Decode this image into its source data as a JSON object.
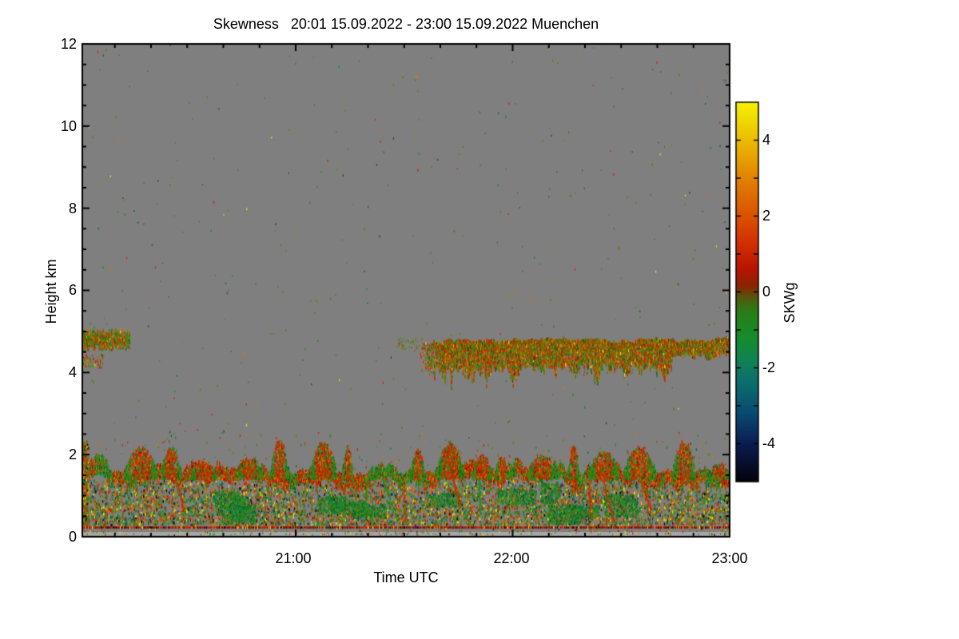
{
  "chart_data": {
    "type": "heatmap",
    "display_title": "Skewness   20:01 15.09.2022 - 23:00 15.09.2022 Muenchen",
    "variable": "Skewness",
    "time_start": "20:01 15.09.2022",
    "time_end": "23:00 15.09.2022",
    "station": "Muenchen",
    "x": {
      "label": "Time UTC",
      "range_minutes": [
        0,
        179
      ],
      "tick_minutes": [
        59,
        119,
        179
      ],
      "tick_labels": [
        "21:00",
        "22:00",
        "23:00"
      ],
      "minor_step_min": 10,
      "first_minor_min": 9
    },
    "y": {
      "label": "Height km",
      "range": [
        0,
        12
      ],
      "tick_values": [
        12,
        10,
        8,
        6,
        4,
        2,
        0
      ],
      "tick_labels": [
        "12",
        "10",
        "8",
        "6",
        "4",
        "2",
        "0"
      ],
      "minor_step": 0.5
    },
    "colorbar": {
      "label": "SKWg",
      "range": [
        -5,
        5
      ],
      "tick_values": [
        4,
        2,
        0,
        -2,
        -4
      ],
      "tick_labels": [
        "4",
        "2",
        "0",
        "-2",
        "-4"
      ],
      "minor_tick_values": [
        3,
        1,
        -1,
        -3
      ],
      "gradient_stops": [
        [
          0,
          "#f6f200"
        ],
        [
          0.05,
          "#f0d800"
        ],
        [
          0.13,
          "#e8ab00"
        ],
        [
          0.22,
          "#e07800"
        ],
        [
          0.3,
          "#da5200"
        ],
        [
          0.38,
          "#d02c00"
        ],
        [
          0.44,
          "#b81400"
        ],
        [
          0.485,
          "#8a2404"
        ],
        [
          0.515,
          "#55570e"
        ],
        [
          0.55,
          "#2a7d18"
        ],
        [
          0.62,
          "#168c2c"
        ],
        [
          0.68,
          "#108353"
        ],
        [
          0.74,
          "#0c6d6e"
        ],
        [
          0.82,
          "#094a70"
        ],
        [
          0.9,
          "#0c1c50"
        ],
        [
          1,
          "#03030c"
        ]
      ]
    },
    "background_color": "#7f7f7f",
    "palette": {
      "olive": "#6e7b08",
      "green": "#1d8c22",
      "dgreen": "#0e661a",
      "red": "#cd2800",
      "dred": "#8e1400",
      "orange": "#d97800",
      "yellow": "#ecd800",
      "teal": "#0c7260",
      "navy": "#182a60",
      "black": "#0b0b0b"
    },
    "seed": 20220915,
    "features": [
      {
        "id": "ambient-speckle",
        "h_km": [
          1.5,
          12
        ],
        "count": 400
      },
      {
        "id": "mid-speckle",
        "h_km": [
          1.55,
          2.6
        ],
        "count": 140
      },
      {
        "id": "cloud-left",
        "t_min": [
          0,
          13
        ],
        "h_center_km": 4.82,
        "h_range_km": [
          4.45,
          5.1
        ],
        "count": 900
      },
      {
        "id": "cloud-main",
        "t_min": [
          93,
          179
        ],
        "h_top_km": 4.8,
        "h_base_km": 4.25,
        "base_sag_km": 0.35,
        "thin_after_min": 163,
        "thin_base_km": 4.5
      },
      {
        "id": "mixed-layer",
        "h_center_km": 1.5,
        "thickness_km": 0.22
      },
      {
        "id": "towers",
        "h_top_km": [
          1.78,
          2.35
        ],
        "h_base_km": 1.42
      },
      {
        "id": "bl-speckle",
        "h_km": [
          0.3,
          1.42
        ],
        "count": 7000
      },
      {
        "id": "green-patches",
        "count": 12,
        "h_km": [
          0.55,
          1.15
        ]
      },
      {
        "id": "diagonal-streaks",
        "count": 9
      },
      {
        "id": "left-edge-strip",
        "t_max_min": 1.6,
        "h_km": [
          0.3,
          2.35
        ],
        "count": 340
      },
      {
        "id": "surface-line",
        "h_km": 0.25
      },
      {
        "id": "sub-line-speckle",
        "h_km": [
          0.05,
          0.22
        ],
        "count": 280
      },
      {
        "id": "surface-strip",
        "h_km": [
          0.03,
          0.115
        ],
        "color": "#a9a9a9"
      }
    ]
  }
}
